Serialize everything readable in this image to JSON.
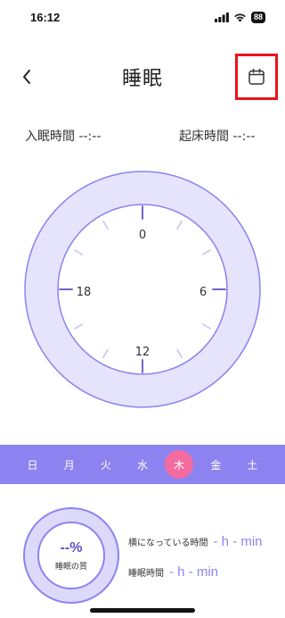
{
  "status_bar": {
    "time": "16:12",
    "battery": "88"
  },
  "header": {
    "title": "睡眠"
  },
  "times": {
    "bedtime": "入眠時間 --:--",
    "waketime": "起床時間 --:--"
  },
  "clock": {
    "labels": {
      "top": "0",
      "right": "6",
      "bottom": "12",
      "left": "18"
    }
  },
  "weekdays": [
    {
      "label": "日",
      "active": false
    },
    {
      "label": "月",
      "active": false
    },
    {
      "label": "火",
      "active": false
    },
    {
      "label": "水",
      "active": false
    },
    {
      "label": "木",
      "active": true
    },
    {
      "label": "金",
      "active": false
    },
    {
      "label": "土",
      "active": false
    }
  ],
  "summary": {
    "quality_value": "--%",
    "quality_label": "睡眠の質",
    "lying_label": "横になっている時間",
    "lying_value": "- h - min",
    "sleep_label": "睡眠時間",
    "sleep_value": "- h - min"
  },
  "colors": {
    "accent": "#8c83f0",
    "active_day": "#f46ba0",
    "highlight": "#e8151b",
    "ring_fill": "#e6e3fc"
  }
}
